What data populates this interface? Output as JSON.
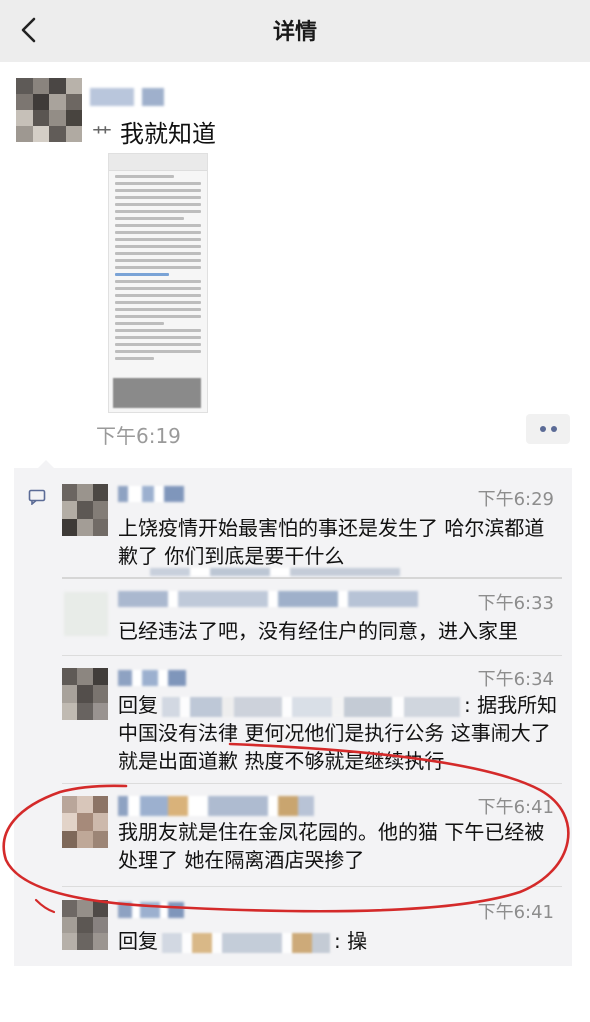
{
  "header": {
    "title": "详情"
  },
  "post": {
    "prefix": "艹",
    "text": "我就知道",
    "time": "下午6:19"
  },
  "comments": [
    {
      "time": "下午6:29",
      "text": "上饶疫情开始最害怕的事还是发生了 哈尔滨都道歉了 你们到底是要干什么"
    },
    {
      "time": "下午6:33",
      "text": "已经违法了吧，没有经住户的同意，进入家里"
    },
    {
      "time": "下午6:34",
      "reply_prefix": "回复",
      "reply_suffix": ": 据我所知中国没有法律 更何况他们是执行公务 这事闹大了就是出面道歉 热度不够就是继续执行"
    },
    {
      "time": "下午6:41",
      "text": "我朋友就是住在金凤花园的。他的猫 下午已经被处理了 她在隔离酒店哭掺了"
    },
    {
      "time": "下午6:41",
      "reply_prefix": "回复",
      "reply_suffix": ": 操"
    }
  ],
  "colors": {
    "header_bg": "#ededed",
    "comments_bg": "#f3f3f5",
    "link_blue": "#5b6b96",
    "annotation_red": "#d42a2a"
  },
  "icons": {
    "back": "chevron-left-icon",
    "more": "more-dots-icon",
    "comment": "comment-icon"
  }
}
